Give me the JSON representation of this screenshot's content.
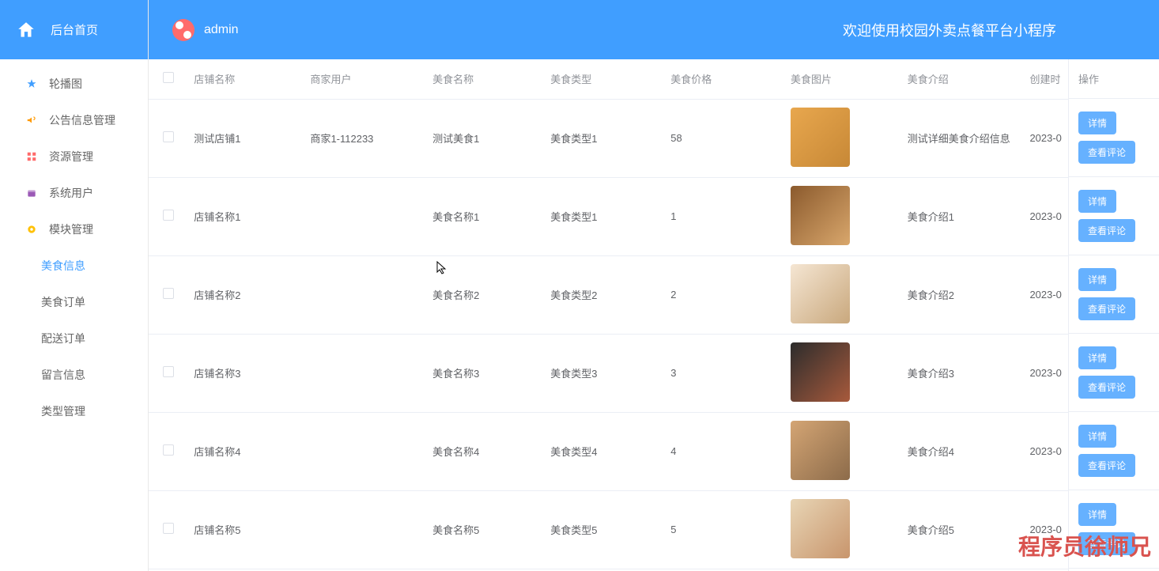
{
  "sidebar": {
    "home_title": "后台首页",
    "menu": [
      {
        "label": "轮播图",
        "icon": "star",
        "color": "#409EFF"
      },
      {
        "label": "公告信息管理",
        "icon": "bullhorn",
        "color": "#FF9900"
      },
      {
        "label": "资源管理",
        "icon": "grid",
        "color": "#FF6B6B"
      },
      {
        "label": "系统用户",
        "icon": "box",
        "color": "#9B59B6"
      },
      {
        "label": "模块管理",
        "icon": "badge",
        "color": "#FFC107"
      }
    ],
    "submenu": [
      {
        "label": "美食信息",
        "active": true
      },
      {
        "label": "美食订单",
        "active": false
      },
      {
        "label": "配送订单",
        "active": false
      },
      {
        "label": "留言信息",
        "active": false
      },
      {
        "label": "类型管理",
        "active": false
      }
    ]
  },
  "topbar": {
    "username": "admin",
    "title": "欢迎使用校园外卖点餐平台小程序"
  },
  "table": {
    "headers": {
      "shop": "店铺名称",
      "merchant": "商家用户",
      "food_name": "美食名称",
      "food_type": "美食类型",
      "food_price": "美食价格",
      "food_img": "美食图片",
      "food_intro": "美食介绍",
      "create_time": "创建时",
      "actions": "操作"
    },
    "rows": [
      {
        "shop": "测试店铺1",
        "merchant": "商家1-112233",
        "food_name": "测试美食1",
        "food_type": "美食类型1",
        "food_price": "58",
        "intro": "测试详细美食介绍信息",
        "time": "2023-0",
        "img_colors": [
          "#e8a74e",
          "#c78836"
        ]
      },
      {
        "shop": "店铺名称1",
        "merchant": "",
        "food_name": "美食名称1",
        "food_type": "美食类型1",
        "food_price": "1",
        "intro": "美食介绍1",
        "time": "2023-0",
        "img_colors": [
          "#8b5a2d",
          "#d9a76c"
        ]
      },
      {
        "shop": "店铺名称2",
        "merchant": "",
        "food_name": "美食名称2",
        "food_type": "美食类型2",
        "food_price": "2",
        "intro": "美食介绍2",
        "time": "2023-0",
        "img_colors": [
          "#f5e6d3",
          "#c9a87d"
        ]
      },
      {
        "shop": "店铺名称3",
        "merchant": "",
        "food_name": "美食名称3",
        "food_type": "美食类型3",
        "food_price": "3",
        "intro": "美食介绍3",
        "time": "2023-0",
        "img_colors": [
          "#2c2c2c",
          "#a85a3c"
        ]
      },
      {
        "shop": "店铺名称4",
        "merchant": "",
        "food_name": "美食名称4",
        "food_type": "美食类型4",
        "food_price": "4",
        "intro": "美食介绍4",
        "time": "2023-0",
        "img_colors": [
          "#d4a574",
          "#8c6b4a"
        ]
      },
      {
        "shop": "店铺名称5",
        "merchant": "",
        "food_name": "美食名称5",
        "food_type": "美食类型5",
        "food_price": "5",
        "intro": "美食介绍5",
        "time": "2023-0",
        "img_colors": [
          "#e8d5b5",
          "#c8956c"
        ]
      }
    ],
    "action_labels": {
      "detail": "详情",
      "comments": "查看评论"
    }
  },
  "watermark": "程序员徐师兄"
}
